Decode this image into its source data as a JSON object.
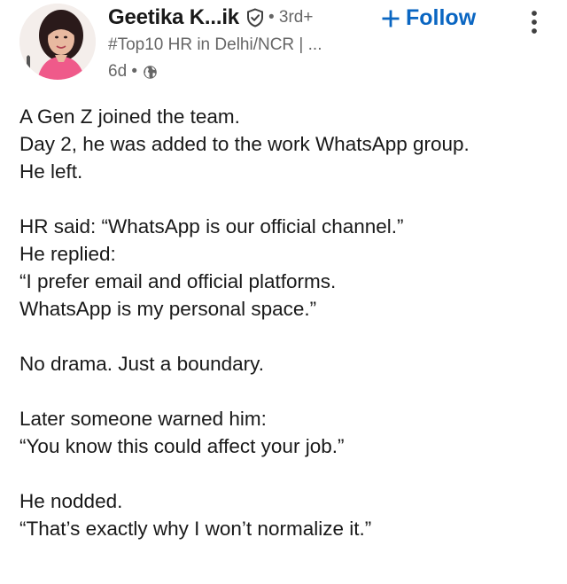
{
  "author": {
    "name": "Geetika K...ik",
    "degree": "• 3rd+",
    "headline": "#Top10 HR in Delhi/NCR | ...",
    "time": "6d •"
  },
  "actions": {
    "follow_label": "Follow"
  },
  "post": {
    "lines": [
      "A Gen Z joined the team.",
      "Day 2, he was added to the work WhatsApp group.",
      "He left.",
      "",
      "HR said: “WhatsApp is our official channel.”",
      "He replied:",
      "“I prefer email and official platforms.",
      "WhatsApp is my personal space.”",
      "",
      "No drama. Just a boundary.",
      "",
      "Later someone warned him:",
      "“You know this could affect your job.”",
      "",
      "He nodded.",
      "“That’s exactly why I won’t normalize it.”"
    ]
  },
  "icons": {
    "verified": "shield-check-icon",
    "visibility": "globe-icon",
    "follow": "plus-icon",
    "more": "more-vertical-icon"
  },
  "colors": {
    "accent": "#0a66c2",
    "text": "#191919",
    "secondary": "#666666"
  }
}
